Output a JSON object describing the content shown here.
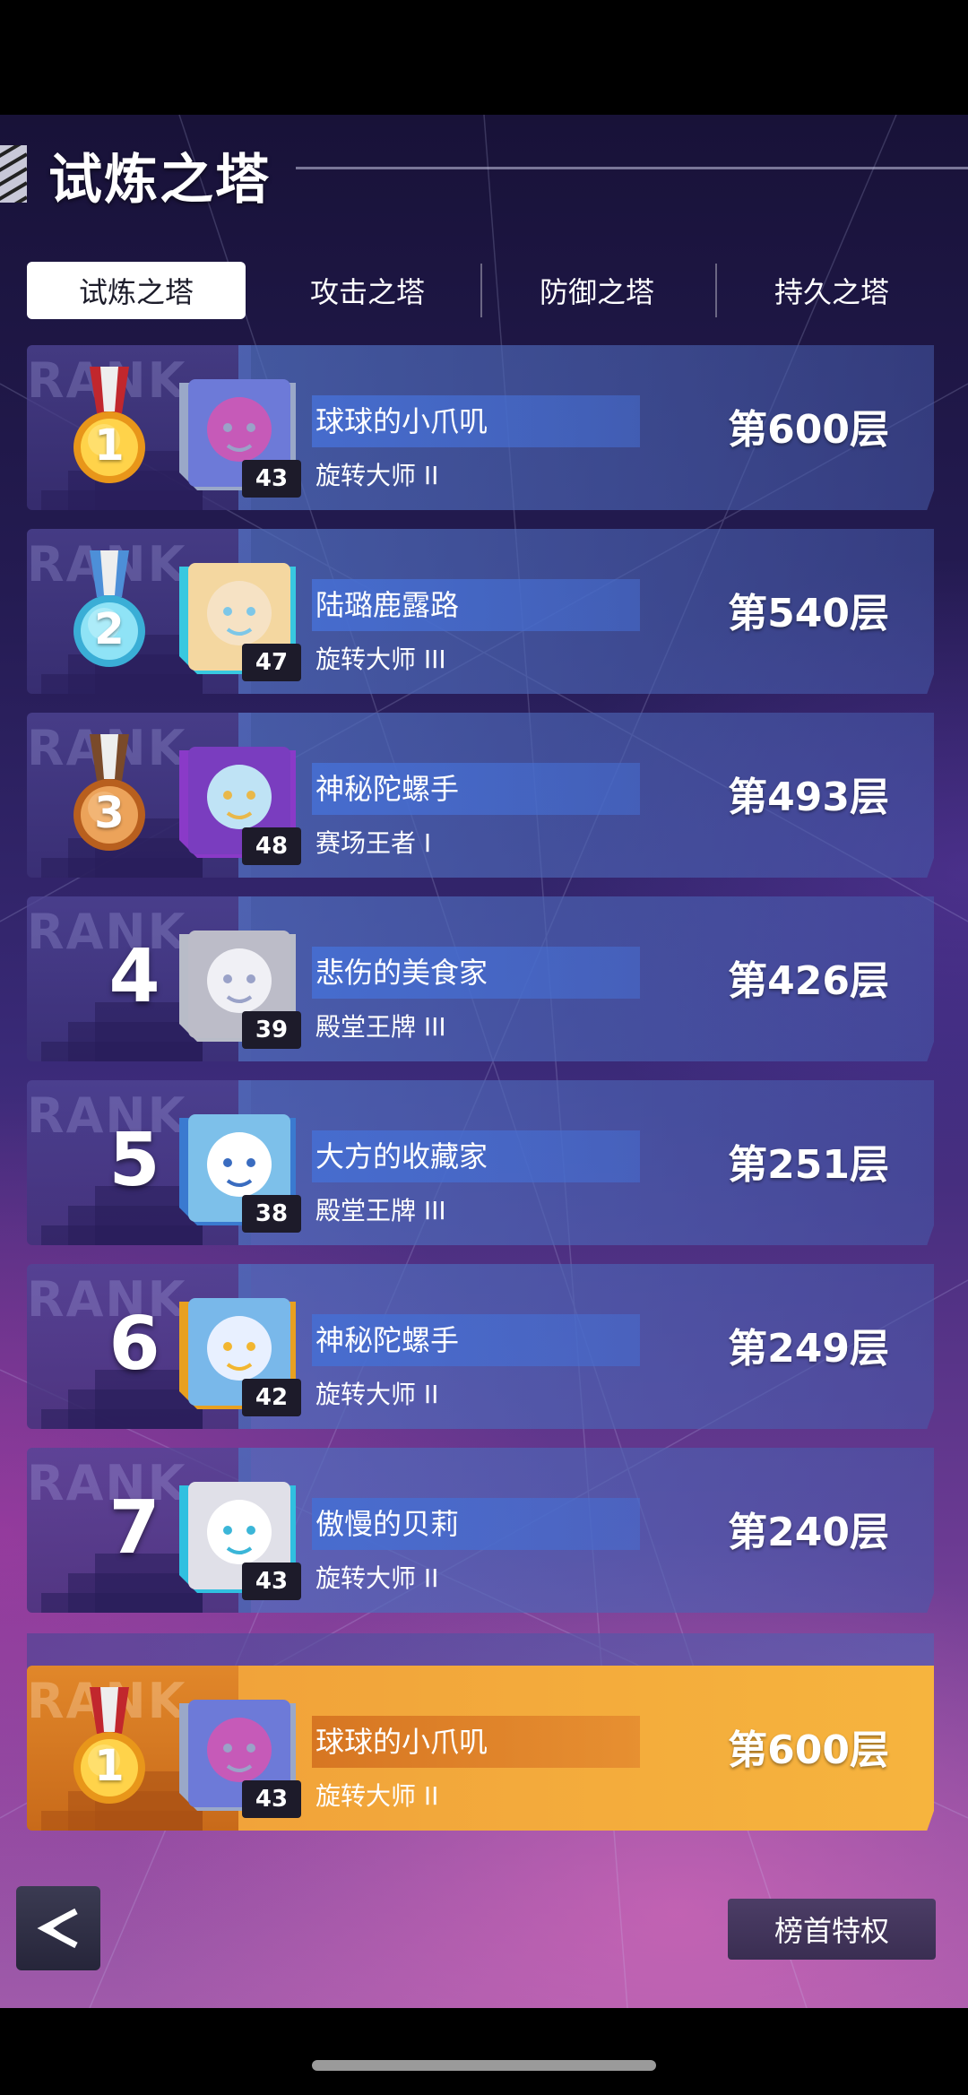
{
  "page": {
    "title": "试炼之塔"
  },
  "tabs": [
    {
      "label": "试炼之塔",
      "active": true
    },
    {
      "label": "攻击之塔",
      "active": false
    },
    {
      "label": "防御之塔",
      "active": false
    },
    {
      "label": "持久之塔",
      "active": false
    }
  ],
  "rank_watermark": "RANK",
  "ranks": [
    {
      "rank": "1",
      "medal": "gold-medal",
      "level": "43",
      "name": "球球的小爪叽",
      "title": "旋转大师 II",
      "floor": "第600层"
    },
    {
      "rank": "2",
      "medal": "silver-medal",
      "level": "47",
      "name": "陆璐鹿露路",
      "title": "旋转大师 III",
      "floor": "第540层"
    },
    {
      "rank": "3",
      "medal": "bronze-medal",
      "level": "48",
      "name": "神秘陀螺手",
      "title": "赛场王者 I",
      "floor": "第493层"
    },
    {
      "rank": "4",
      "level": "39",
      "name": "悲伤的美食家",
      "title": "殿堂王牌 III",
      "floor": "第426层"
    },
    {
      "rank": "5",
      "level": "38",
      "name": "大方的收藏家",
      "title": "殿堂王牌 III",
      "floor": "第251层"
    },
    {
      "rank": "6",
      "level": "42",
      "name": "神秘陀螺手",
      "title": "旋转大师 II",
      "floor": "第249层"
    },
    {
      "rank": "7",
      "level": "43",
      "name": "傲慢的贝莉",
      "title": "旋转大师 II",
      "floor": "第240层"
    }
  ],
  "my_rank": {
    "rank": "1",
    "medal": "gold-medal",
    "level": "43",
    "name": "球球的小爪叽",
    "title": "旋转大师 II",
    "floor": "第600层"
  },
  "buttons": {
    "privilege": "榜首特权"
  },
  "colors": {
    "accent_orange": "#f1a33a",
    "row_blue": "#4f6ebe",
    "gold": "#f4b32a",
    "silver": "#56c8e8",
    "bronze": "#d67a30"
  }
}
